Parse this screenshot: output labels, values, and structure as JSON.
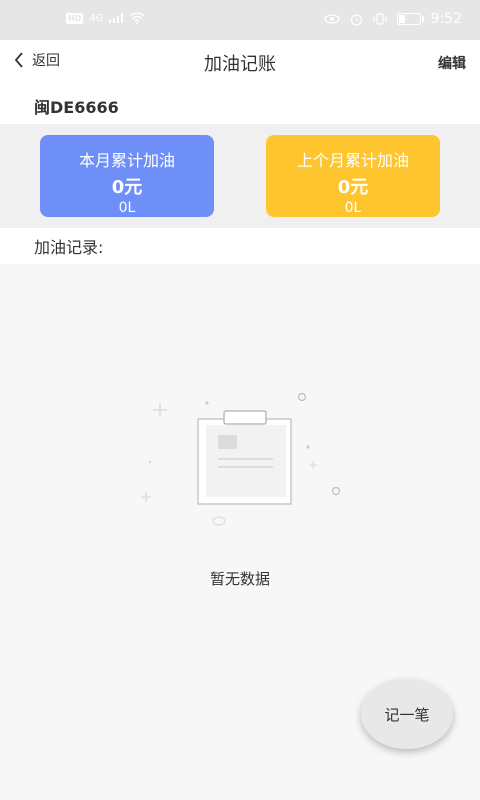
{
  "status_bar": {
    "network": "4G",
    "time": "9:52"
  },
  "nav": {
    "back_label": "返回",
    "title": "加油记账",
    "edit_label": "编辑"
  },
  "vehicle": {
    "plate": "闽DE6666"
  },
  "summary": {
    "this_month": {
      "title": "本月累计加油",
      "amount": "0元",
      "liters": "0L",
      "color": "#6e8ff7"
    },
    "last_month": {
      "title": "上个月累计加油",
      "amount": "0元",
      "liters": "0L",
      "color": "#fec52e"
    }
  },
  "records": {
    "label": "加油记录:",
    "empty_text": "暂无数据"
  },
  "fab": {
    "label": "记一笔"
  }
}
